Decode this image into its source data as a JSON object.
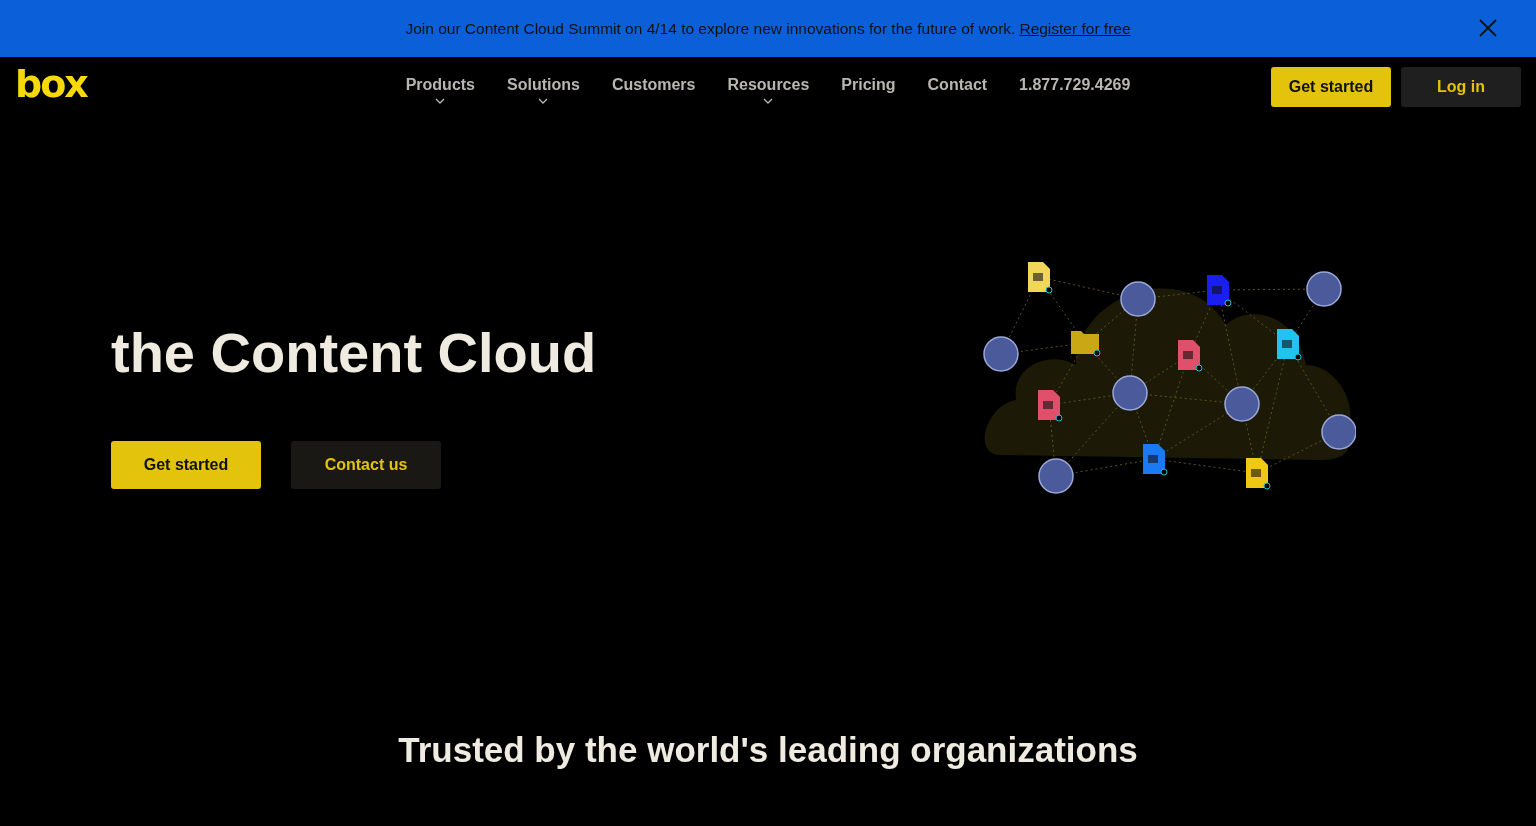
{
  "banner": {
    "message": "Join our Content Cloud Summit on 4/14 to explore new innovations for the future of work.",
    "link": "Register for free"
  },
  "header": {
    "logo": "box",
    "nav": [
      {
        "label": "Products",
        "has_menu": true
      },
      {
        "label": "Solutions",
        "has_menu": true
      },
      {
        "label": "Customers",
        "has_menu": false
      },
      {
        "label": "Resources",
        "has_menu": true
      },
      {
        "label": "Pricing",
        "has_menu": false
      },
      {
        "label": "Contact",
        "has_menu": false
      },
      {
        "label": "1.877.729.4269",
        "has_menu": false
      }
    ],
    "buttons": [
      {
        "label": "Get started",
        "kind": "primary"
      },
      {
        "label": "Log in",
        "kind": "secondary"
      }
    ]
  },
  "hero": {
    "title": "the Content Cloud",
    "buttons": [
      {
        "label": "Get started",
        "kind": "primary"
      },
      {
        "label": "Contact us",
        "kind": "secondary"
      }
    ]
  },
  "trusted": {
    "heading": "Trusted by the world's leading organizations"
  }
}
